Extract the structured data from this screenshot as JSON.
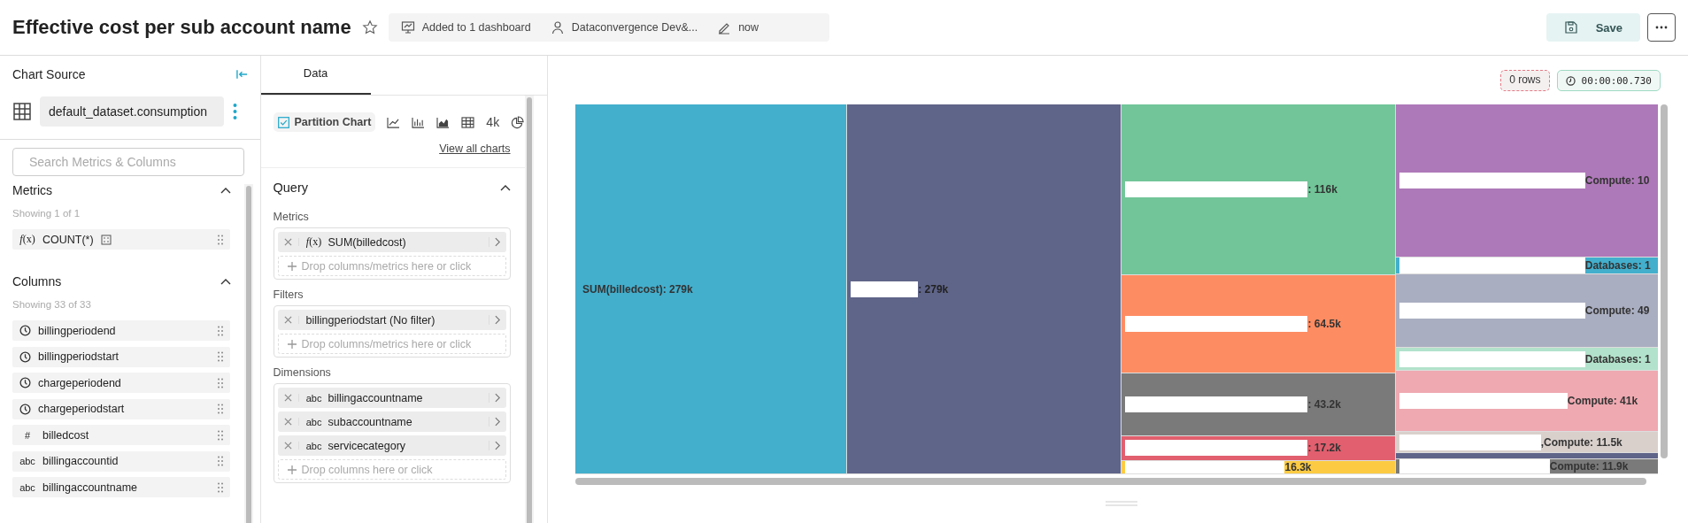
{
  "header": {
    "title": "Effective cost per sub account name",
    "starred": false,
    "meta": [
      {
        "kind": "dashboard",
        "text": "Added to 1 dashboard"
      },
      {
        "kind": "user",
        "text": "Dataconvergence Dev&..."
      },
      {
        "kind": "edit",
        "text": "now"
      }
    ],
    "save_button": "Save"
  },
  "source_panel": {
    "title": "Chart Source",
    "dataset": "default_dataset.consumption",
    "search": {
      "placeholder": "Search Metrics & Columns"
    },
    "sections": [
      {
        "title": "Metrics",
        "expanded": true,
        "count": "Showing 1 of 1",
        "items": [
          {
            "kind": "fx",
            "type_text": "*f*(x)",
            "name": "COUNT(*)"
          }
        ]
      },
      {
        "title": "Columns",
        "expanded": true,
        "count": "Showing 33 of 33",
        "items": [
          {
            "kind": "time",
            "name": "billingperiodend"
          },
          {
            "kind": "time",
            "name": "billingperiodstart"
          },
          {
            "kind": "time",
            "name": "chargeperiodend"
          },
          {
            "kind": "time",
            "name": "chargeperiodstart"
          },
          {
            "kind": "number",
            "type_text": "#",
            "name": "billedcost"
          },
          {
            "kind": "text",
            "type_text": "abc",
            "name": "billingaccountid"
          },
          {
            "kind": "text",
            "type_text": "abc",
            "name": "billingaccountname"
          }
        ]
      }
    ]
  },
  "data_panel": {
    "tabs": [
      {
        "label": "Data",
        "selected": true
      }
    ],
    "chart_types": [
      {
        "kind": "partition",
        "label": "Partition Chart",
        "selected": true
      },
      {
        "kind": "line",
        "selected": false
      },
      {
        "kind": "bar",
        "selected": false
      },
      {
        "kind": "area",
        "selected": false
      },
      {
        "kind": "table",
        "selected": false
      },
      {
        "kind": "bignumber",
        "label": "4k",
        "selected": false
      },
      {
        "kind": "pie",
        "selected": false
      }
    ],
    "view_all": "View all charts",
    "query": {
      "title": "Query",
      "expanded": true,
      "sections": [
        {
          "label": "Metrics",
          "items": [
            {
              "kind": "fx",
              "type_text": "*f*(x)",
              "name": "SUM(billedcost)"
            }
          ],
          "drop": "Drop columns/metrics here or click"
        },
        {
          "label": "Filters",
          "items": [
            {
              "name": "billingperiodstart (No filter)"
            }
          ],
          "drop": "Drop columns/metrics here or click"
        },
        {
          "label": "Dimensions",
          "items": [
            {
              "kind": "text",
              "type_text": "abc",
              "name": "billingaccountname"
            },
            {
              "kind": "text",
              "type_text": "abc",
              "name": "subaccountname"
            },
            {
              "kind": "text",
              "type_text": "abc",
              "name": "servicecategory"
            }
          ],
          "drop": "Drop columns here or click"
        }
      ]
    }
  },
  "result": {
    "rows_badge": "0 rows",
    "time_badge": "00:00:00.730",
    "partition": [
      [
        {
          "color": "#43afcd",
          "redacted": false,
          "label": "SUM(billedcost): 279k"
        }
      ],
      [
        {
          "color": "#5f6489",
          "redacted": true,
          "label": ": 279k"
        }
      ],
      [
        {
          "color": "#71c598",
          "redacted": true,
          "label": ": 116k"
        },
        {
          "color": "#fe8c62",
          "redacted": true,
          "label": ": 64.5k"
        },
        {
          "color": "#7a7a7a",
          "redacted": true,
          "label": ": 43.2k"
        },
        {
          "color": "#e15f6e",
          "redacted": true,
          "label": ": 17.2k"
        },
        {
          "color": "#fccb43",
          "redacted": true,
          "label": "16.3k"
        }
      ],
      [
        {
          "color": "#ae79b9",
          "redacted": true,
          "label": "Compute: 10"
        },
        {
          "color": "#43afcd",
          "redacted": true,
          "label": "Databases: 1"
        },
        {
          "color": "#aaaec1",
          "redacted": true,
          "label": "Compute: 49"
        },
        {
          "color": "#b2e2cb",
          "redacted": true,
          "label": "Databases: 1"
        },
        {
          "color": "#efa9b1",
          "redacted": true,
          "label": "Compute: 41k"
        },
        {
          "color": "#d9d0cc",
          "redacted": true,
          "label": ",Compute: 11.5k"
        },
        {
          "color": "#5f6489"
        },
        {
          "color": "#7a7a7a",
          "redacted": true,
          "label": "Compute: 11.9k"
        }
      ]
    ]
  }
}
